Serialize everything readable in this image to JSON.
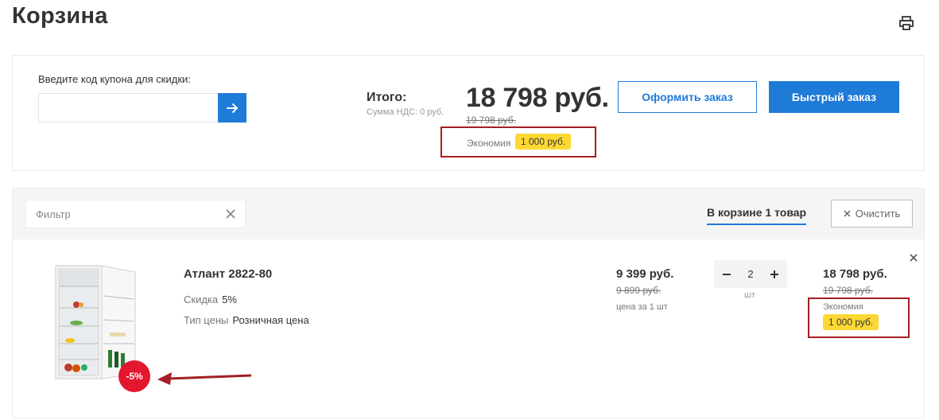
{
  "page": {
    "title": "Корзина"
  },
  "icons": {
    "print": "printer-icon",
    "coupon_submit": "arrow-right-icon",
    "filter_clear": "close-icon",
    "clear_cart": "close-icon",
    "remove_item": "close-icon"
  },
  "colors": {
    "accent": "#1f7bd8",
    "badge_yellow": "#fdd835",
    "discount_red": "#e3172d",
    "annotation_red": "#a31f24"
  },
  "coupon": {
    "label": "Введите код купона для скидки:",
    "value": "",
    "placeholder": ""
  },
  "summary": {
    "total_label": "Итого:",
    "vat_text": "Сумма НДС: 0 руб.",
    "total_price": "18 798 руб.",
    "old_price": "19 798 руб.",
    "savings_label": "Экономия",
    "savings_value": "1 000 руб.",
    "order_button": "Оформить заказ",
    "quick_order_button": "Быстрый заказ"
  },
  "cart": {
    "filter_placeholder": "Фильтр",
    "count_label": "В корзине 1 товар",
    "clear_label": "Очистить",
    "items": [
      {
        "name": "Атлант 2822-80",
        "discount_badge": "-5%",
        "props": [
          {
            "key": "Скидка",
            "value": "5%"
          },
          {
            "key": "Тип цены",
            "value": "Розничная цена"
          }
        ],
        "unit_price": "9 399 руб.",
        "unit_old_price": "9 899 руб.",
        "unit_note": "цена за 1 шт",
        "quantity": "2",
        "quantity_unit": "шт",
        "total_price": "18 798 руб.",
        "total_old_price": "19 798 руб.",
        "savings_label": "Экономия",
        "savings_value": "1 000 руб."
      }
    ]
  }
}
